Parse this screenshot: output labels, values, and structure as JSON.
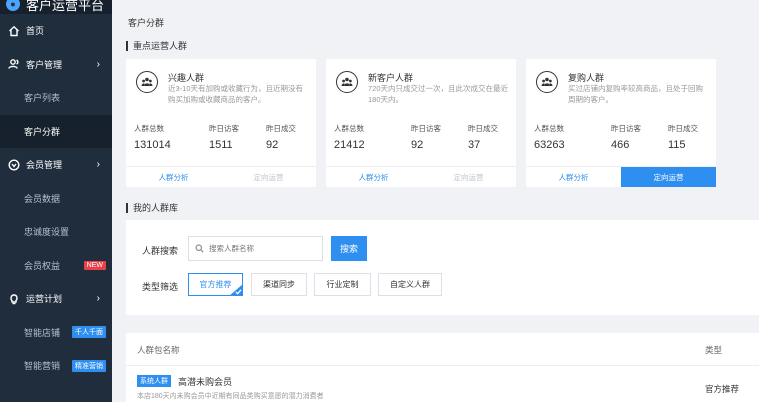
{
  "app": {
    "title": "客户运营平台"
  },
  "sidebar": {
    "items": [
      {
        "label": "首页",
        "icon": "home-icon"
      },
      {
        "label": "客户管理",
        "icon": "users-icon"
      },
      {
        "label": "客户列表"
      },
      {
        "label": "客户分群"
      },
      {
        "label": "会员管理",
        "icon": "member-icon"
      },
      {
        "label": "会员数据"
      },
      {
        "label": "忠诚度设置"
      },
      {
        "label": "会员权益",
        "tag": "NEW"
      },
      {
        "label": "运营计划",
        "icon": "bulb-icon"
      },
      {
        "label": "智能店铺",
        "tag": "千人千面"
      },
      {
        "label": "智能营销",
        "tag": "精准营销"
      }
    ]
  },
  "page": {
    "breadcrumb": "客户分群",
    "key_section_title": "重点运营人群",
    "lib_section_title": "我的人群库"
  },
  "cards": [
    {
      "title": "兴趣人群",
      "desc": "近3-10天有加购或收藏行为，且近期没有购买加购或收藏商品的客户。",
      "stats": [
        {
          "label": "人群总数",
          "value": "131014"
        },
        {
          "label": "昨日访客",
          "value": "1511"
        },
        {
          "label": "昨日成交",
          "value": "92"
        }
      ],
      "actions": [
        "人群分析",
        "定向运营"
      ]
    },
    {
      "title": "新客户人群",
      "desc": "720天内只成交过一次，且此次成交在最近180天内。",
      "stats": [
        {
          "label": "人群总数",
          "value": "21412"
        },
        {
          "label": "昨日访客",
          "value": "92"
        },
        {
          "label": "昨日成交",
          "value": "37"
        }
      ],
      "actions": [
        "人群分析",
        "定向运营"
      ]
    },
    {
      "title": "复购人群",
      "desc": "买过店铺内复购率较高商品，且处于回购周期的客户。",
      "stats": [
        {
          "label": "人群总数",
          "value": "63263"
        },
        {
          "label": "昨日访客",
          "value": "466"
        },
        {
          "label": "昨日成交",
          "value": "115"
        }
      ],
      "actions": [
        "人群分析",
        "定向运营"
      ]
    }
  ],
  "library": {
    "search_label": "人群搜索",
    "search_placeholder": "搜索人群名称",
    "search_button": "搜索",
    "filter_label": "类型筛选",
    "filters": [
      "官方推荐",
      "渠道同步",
      "行业定制",
      "自定义人群"
    ]
  },
  "table": {
    "headers": [
      "人群包名称",
      "类型"
    ],
    "rows": [
      {
        "badge": "系统人群",
        "name": "高潜未购会员",
        "desc": "本店180天内未购会员中近期有同品类购买意愿的潜力消费者",
        "type": "官方推荐"
      }
    ]
  },
  "colors": {
    "accent": "#2f8ff0",
    "sidebar_bg": "#1f2d3d",
    "new_tag": "#e8414a"
  }
}
